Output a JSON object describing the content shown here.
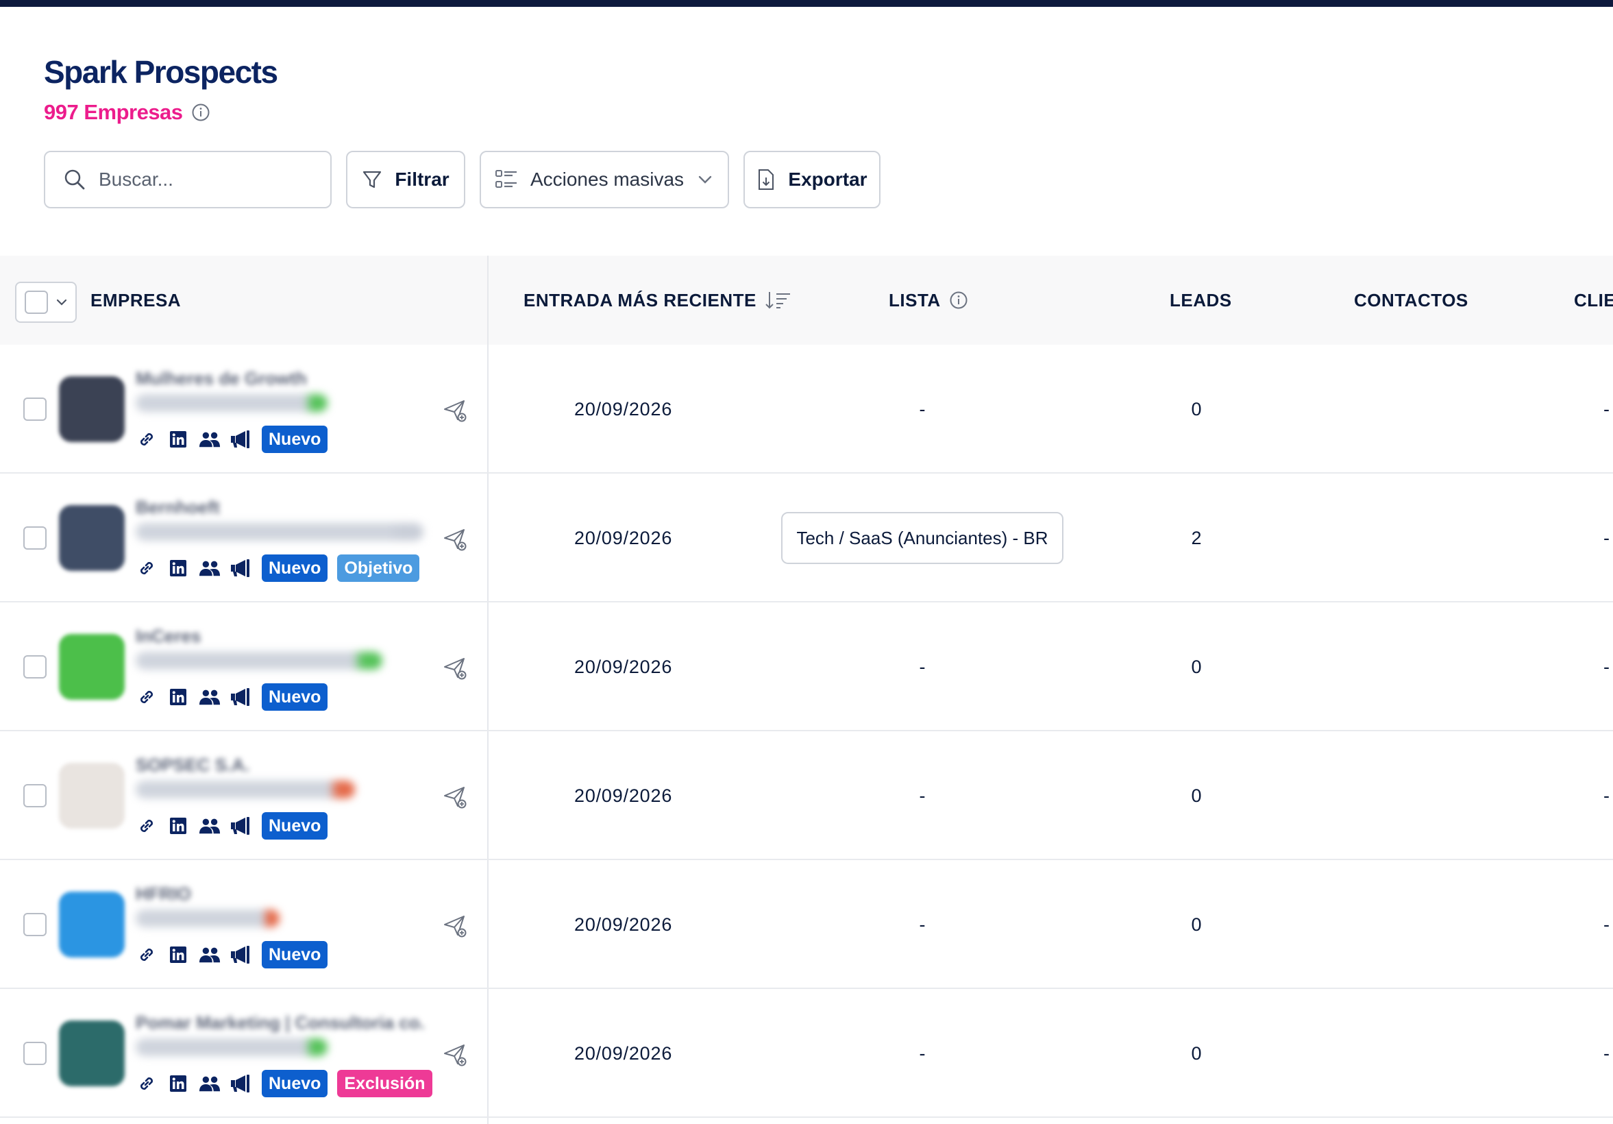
{
  "header": {
    "title": "Spark Prospects",
    "count": "997 Empresas"
  },
  "toolbar": {
    "search_placeholder": "Buscar...",
    "filter_label": "Filtrar",
    "bulk_label": "Acciones masivas",
    "export_label": "Exportar"
  },
  "table": {
    "columns": {
      "empresa": "EMPRESA",
      "entrada": "ENTRADA MÁS RECIENTE",
      "lista": "LISTA",
      "leads": "LEADS",
      "contactos": "CONTACTOS",
      "clientes": "CLIE"
    },
    "rows": [
      {
        "name": "Mulheres de Growth",
        "date": "20/09/2026",
        "list": "-",
        "leads": "0",
        "cli": "-",
        "badge1": "Nuevo",
        "badge2": "",
        "logo_color": "#3b4254",
        "contacts_active": false
      },
      {
        "name": "Bernhoeft",
        "date": "20/09/2026",
        "list": "Tech / SaaS (Anunciantes) - BR",
        "leads": "2",
        "cli": "-",
        "badge1": "Nuevo",
        "badge2": "Objetivo",
        "logo_color": "#3f4d66",
        "contacts_active": true
      },
      {
        "name": "InCeres",
        "date": "20/09/2026",
        "list": "-",
        "leads": "0",
        "cli": "-",
        "badge1": "Nuevo",
        "badge2": "",
        "logo_color": "#4cbf4a",
        "contacts_active": false
      },
      {
        "name": "SOPSEC S.A.",
        "date": "20/09/2026",
        "list": "-",
        "leads": "0",
        "cli": "-",
        "badge1": "Nuevo",
        "badge2": "",
        "logo_color": "#e9e4e0",
        "contacts_active": false
      },
      {
        "name": "HFRIO",
        "date": "20/09/2026",
        "list": "-",
        "leads": "0",
        "cli": "-",
        "badge1": "Nuevo",
        "badge2": "",
        "logo_color": "#2b95e2",
        "contacts_active": false
      },
      {
        "name": "Pomar Marketing | Consultoria co...",
        "date": "20/09/2026",
        "list": "-",
        "leads": "0",
        "cli": "-",
        "badge1": "Nuevo",
        "badge2": "Exclusión",
        "logo_color": "#2c6b6a",
        "contacts_active": false
      }
    ]
  },
  "colors": {
    "brand_navy": "#0c2461",
    "accent_pink": "#ec1c8c",
    "badge_nuevo": "#0d5fce",
    "badge_objetivo": "#4c9be0",
    "badge_exclusion": "#ee3a96"
  }
}
